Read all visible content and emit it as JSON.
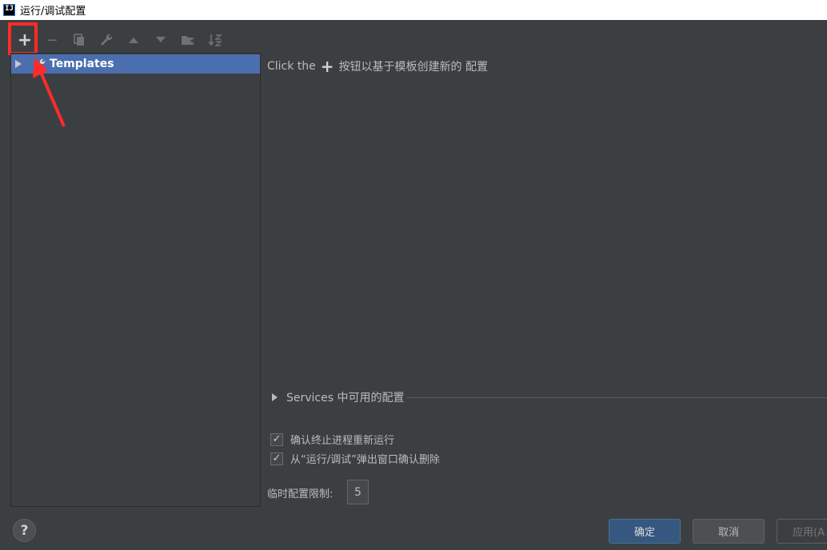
{
  "window": {
    "title": "运行/调试配置",
    "logo_text": "IJ"
  },
  "toolbar": {
    "add": "+",
    "remove": "−"
  },
  "tree": {
    "templates_label": "Templates"
  },
  "main": {
    "hint_prefix": "Click the",
    "hint_plus": "+",
    "hint_suffix": "按钮以基于模板创建新的 配置",
    "services_label": "Services 中可用的配置"
  },
  "options": {
    "confirm_rerun": {
      "label": "确认终止进程重新运行",
      "checked_mark": "✓"
    },
    "confirm_delete": {
      "label": "从“运行/调试”弹出窗口确认删除",
      "checked_mark": "✓"
    },
    "temp_limit_label": "临时配置限制:",
    "temp_limit_value": "5"
  },
  "footer": {
    "help": "?",
    "ok": "确定",
    "cancel": "取消",
    "apply": "应用(A"
  },
  "colors": {
    "background": "#3c3f41",
    "selection": "#4b6eaf",
    "primary_button": "#365880",
    "annotation": "#ff2a2a"
  }
}
